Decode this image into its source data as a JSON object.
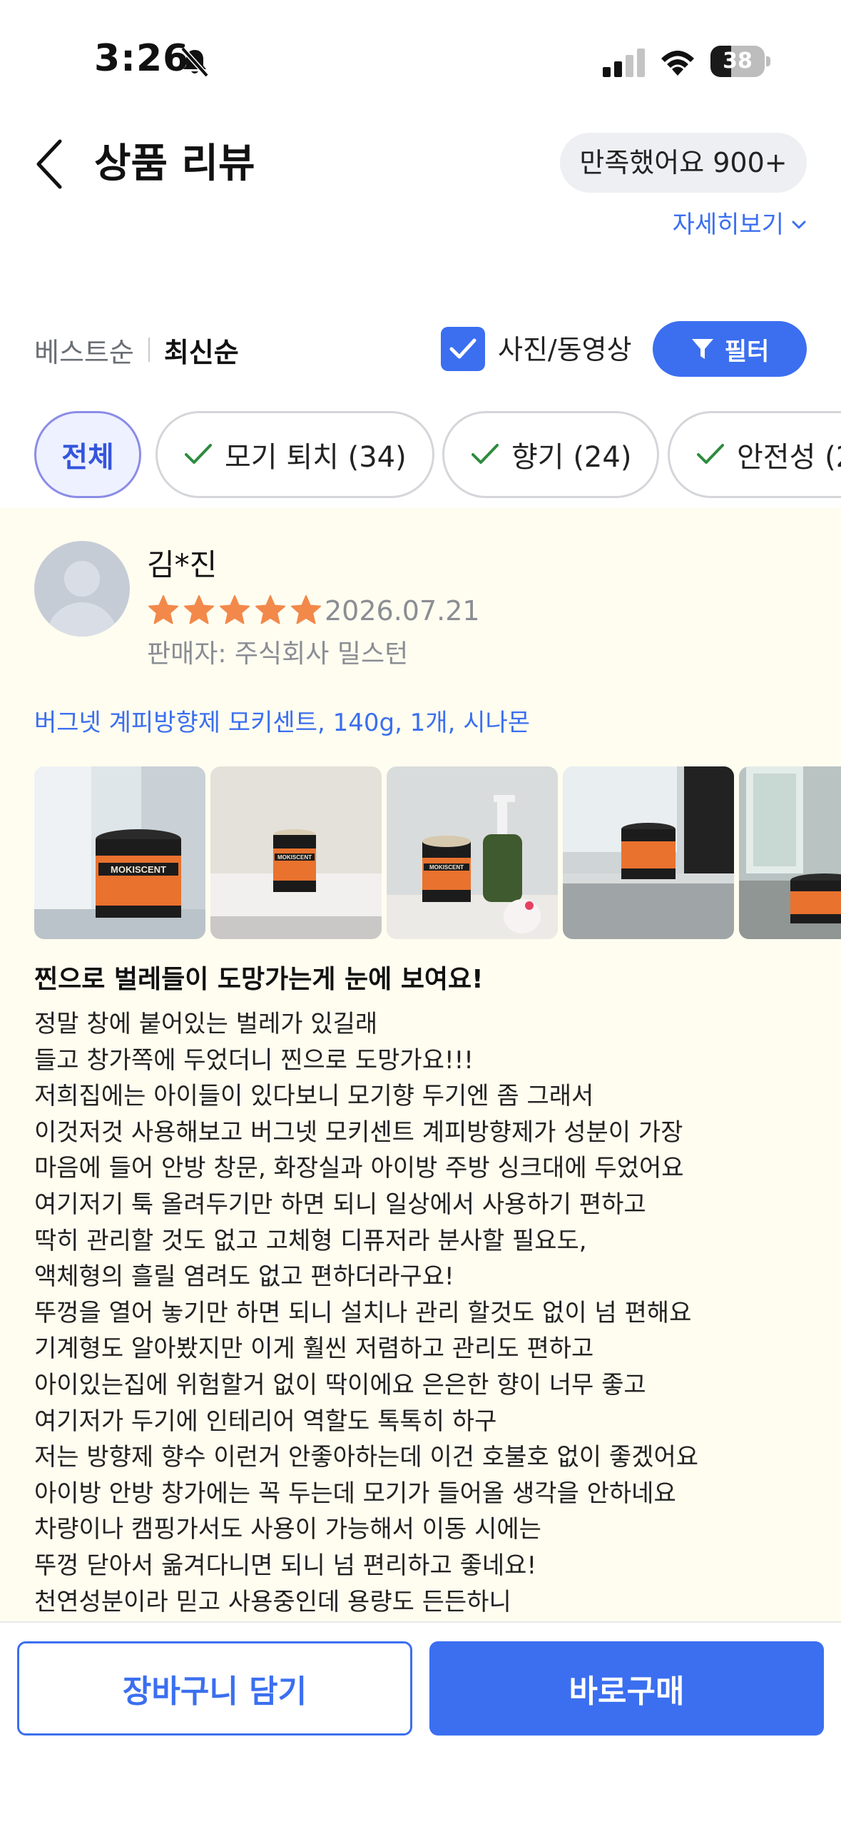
{
  "status_bar": {
    "time": "3:26",
    "battery": "38",
    "battery_level": 0.38
  },
  "header": {
    "title": "상품 리뷰",
    "satisfaction": "만족했어요 900+",
    "detail_link": "자세히보기"
  },
  "sort": {
    "best": "베스트순",
    "latest": "최신순",
    "photo_video_label": "사진/동영상",
    "photo_video_checked": true,
    "filter_label": "필터"
  },
  "chips": [
    {
      "label": "전체",
      "active": true
    },
    {
      "label": "모기 퇴치 (34)",
      "active": false
    },
    {
      "label": "향기 (24)",
      "active": false
    },
    {
      "label": "안전성 (2",
      "active": false
    }
  ],
  "review": {
    "reviewer": "김*진",
    "rating": 5,
    "date": "2026.07.21",
    "seller": "판매자: 주식회사 밀스턴",
    "option": "버그넷 계피방향제 모키센트, 140g, 1개, 시나몬",
    "title": "찐으로 벌레들이 도망가는게 눈에 보여요!",
    "body": [
      "정말 창에 붙어있는 벌레가 있길래",
      "들고 창가쪽에 두었더니 찐으로 도망가요!!!",
      "저희집에는 아이들이 있다보니 모기향 두기엔 좀 그래서",
      "이것저것 사용해보고 버그넷 모키센트 계피방향제가 성분이 가장",
      "마음에 들어 안방 창문, 화장실과 아이방 주방 싱크대에 두었어요",
      "여기저기 툭 올려두기만 하면 되니 일상에서 사용하기 편하고",
      "딱히 관리할 것도 없고 고체형 디퓨저라 분사할 필요도,",
      "액체형의 흘릴 염려도 없고 편하더라구요!",
      "뚜껑을 열어 놓기만 하면 되니 설치나 관리 할것도 없이 넘 편해요",
      "기계형도 알아봤지만 이게 훨씬 저렴하고 관리도 편하고",
      "아이있는집에 위험할거 없이 딱이에요 은은한 향이 너무 좋고",
      "여기저가 두기에 인테리어 역할도 톡톡히 하구",
      "저는 방향제 향수 이런거 안좋아하는데 이건 호불호 없이 좋겠어요",
      "아이방 안방 창가에는 꼭 두는데 모기가 들어올 생각을 안하네요",
      "차량이나 캠핑가서도 사용이 가능해서 이동 시에는",
      "뚜껑 닫아서 옮겨다니면 되니 넘 편리하고 좋네요!",
      "천연성분이라 믿고 사용중인데 용량도 든든하니"
    ],
    "photo_labels": [
      "MOKISCENT",
      "MOKISCENT",
      "MOKISCENT",
      "",
      ""
    ]
  },
  "bottom": {
    "cart": "장바구니 담기",
    "buy": "바로구매"
  },
  "colors": {
    "accent": "#3b6ff0",
    "star": "#f2894a",
    "review_bg": "#fffdf0"
  }
}
